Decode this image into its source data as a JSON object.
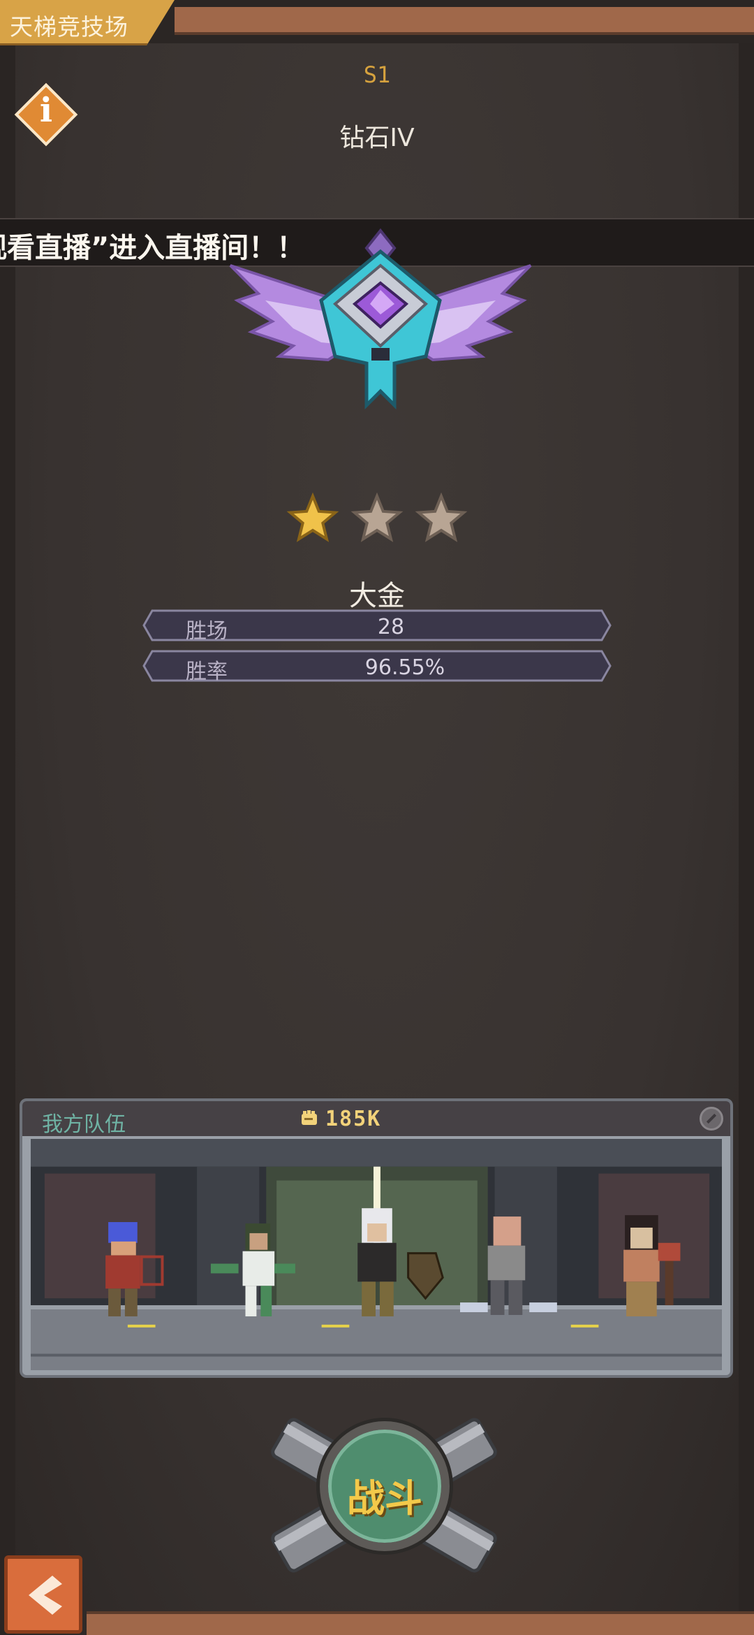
{
  "header": {
    "title": "天梯竞技场"
  },
  "info_button": {
    "icon": "info-icon",
    "glyph": "i"
  },
  "season": "S1",
  "rank": {
    "name": "钻石IV",
    "stars_total": 3,
    "stars_earned": 1
  },
  "broadcast": {
    "text": "观看直播”进入直播间！！"
  },
  "player": {
    "name": "大金"
  },
  "stats": [
    {
      "label": "胜场",
      "value": "28"
    },
    {
      "label": "胜率",
      "value": "96.55%"
    }
  ],
  "team": {
    "title": "我方队伍",
    "power": "185K",
    "power_icon": "fist-icon",
    "settings_icon": "settings-icon"
  },
  "battle_button": {
    "label": "战斗"
  },
  "back_button": {
    "icon": "chevron-left-icon"
  },
  "colors": {
    "background": "#3a3432",
    "accent_gold": "#d6a23e",
    "tab_gold": "#d8a347",
    "battle_green": "#4f8d6e",
    "back_orange": "#d96d3c",
    "emblem_purple": "#b48ae0",
    "emblem_cyan": "#3fc6d6"
  }
}
